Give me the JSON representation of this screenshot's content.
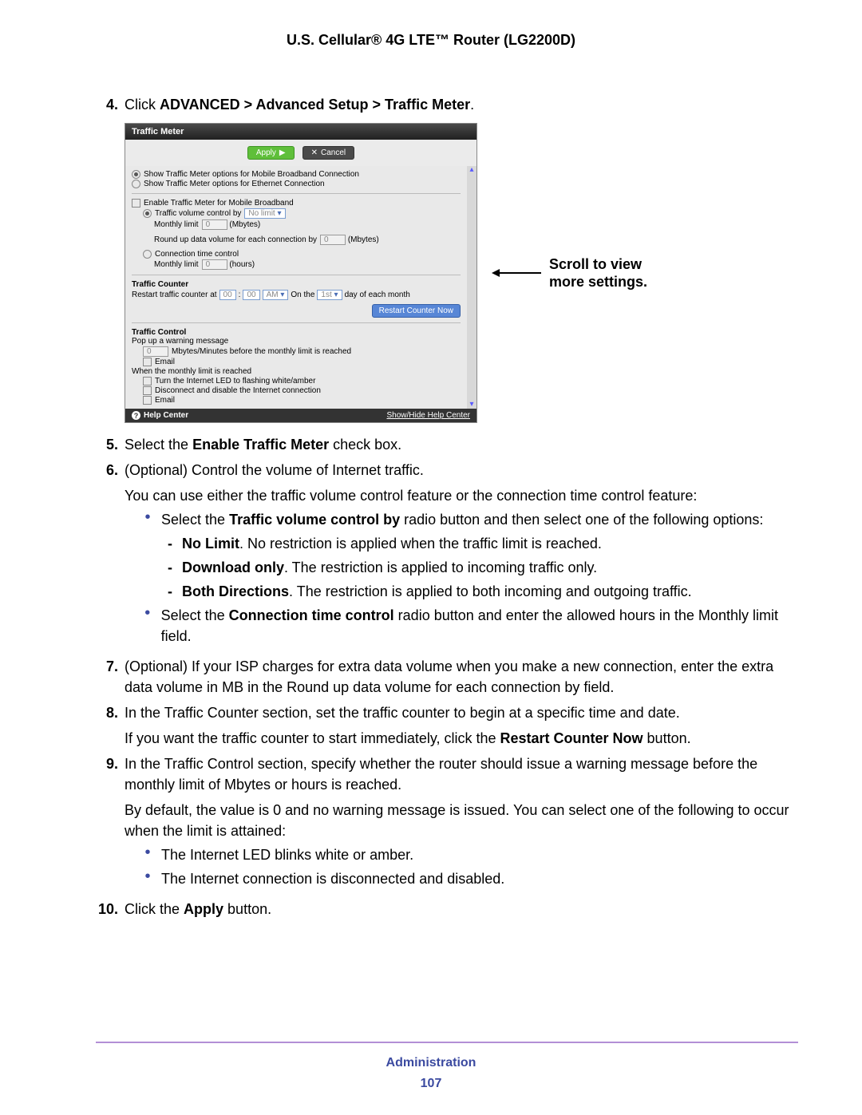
{
  "pageHeader": "U.S. Cellular® 4G LTE™ Router (LG2200D)",
  "callout": "Scroll to view more settings.",
  "shot": {
    "title": "Traffic Meter",
    "apply": "Apply",
    "applyGlyph": "▶",
    "cancel": "Cancel",
    "cancelGlyph": "✕",
    "opt1": "Show Traffic Meter options for Mobile Broadband Connection",
    "opt2": "Show Traffic Meter options for Ethernet Connection",
    "enable": "Enable Traffic Meter for Mobile Broadband",
    "vol_label": "Traffic volume control by",
    "vol_value": "No limit",
    "monthly": "Monthly limit",
    "mbytes": "(Mbytes)",
    "zero": "0",
    "roundup": "Round up data volume for each connection by",
    "conn_time": "Connection time control",
    "monthly2": "Monthly limit",
    "hours": "(hours)",
    "counter_hdr": "Traffic Counter",
    "restart_pre": "Restart traffic counter at",
    "hh": "00",
    "mm": "00",
    "ampm": "AM",
    "onthe": "On the",
    "first": "1st",
    "dayof": "day of each month",
    "restart_btn": "Restart Counter Now",
    "control_hdr": "Traffic Control",
    "popup": "Pop up a warning message",
    "popup_before": "Mbytes/Minutes before the monthly limit is reached",
    "email": "Email",
    "when": "When the monthly limit is reached",
    "led": "Turn the Internet LED to flashing white/amber",
    "disc": "Disconnect and disable the Internet connection",
    "help": "Help Center",
    "help_show": "Show/Hide Help Center"
  },
  "steps": {
    "s4_num": "4.",
    "s4_pre": "Click ",
    "s4_bold": "ADVANCED > Advanced Setup > Traffic Meter",
    "s4_post": ".",
    "s5_num": "5.",
    "s5_pre": "Select the ",
    "s5_bold": "Enable Traffic Meter",
    "s5_post": " check box.",
    "s6_num": "6.",
    "s6": "(Optional) Control the volume of Internet traffic.",
    "s6_p": "You can use either the traffic volume control feature or the connection time control feature:",
    "b1_pre": "Select the ",
    "b1_bold": "Traffic volume control by",
    "b1_post": " radio button and then select one of the following options:",
    "d1_bold": "No Limit",
    "d1_post": ". No restriction is applied when the traffic limit is reached.",
    "d2_bold": "Download only",
    "d2_post": ". The restriction is applied to incoming traffic only.",
    "d3_bold": "Both Directions",
    "d3_post": ". The restriction is applied to both incoming and outgoing traffic.",
    "b2_pre": "Select the ",
    "b2_bold": "Connection time control",
    "b2_post": " radio button and enter the allowed hours in the Monthly limit field.",
    "s7_num": "7.",
    "s7": "(Optional) If your ISP charges for extra data volume when you make a new connection, enter the extra data volume in MB in the Round up data volume for each connection by field.",
    "s8_num": "8.",
    "s8": "In the Traffic Counter section, set the traffic counter to begin at a specific time and date.",
    "s8_p_pre": "If you want the traffic counter to start immediately, click the ",
    "s8_p_bold": "Restart Counter Now",
    "s8_p_post": " button.",
    "s9_num": "9.",
    "s9": "In the Traffic Control section, specify whether the router should issue a warning message before the monthly limit of Mbytes or hours is reached.",
    "s9_p": "By default, the value is 0 and no warning message is issued. You can select one of the following to occur when the limit is attained:",
    "b9a": "The Internet LED blinks white or amber.",
    "b9b": "The Internet connection is disconnected and disabled.",
    "s10_num": "10.",
    "s10_pre": "Click the ",
    "s10_bold": "Apply",
    "s10_post": " button."
  },
  "footer": {
    "section": "Administration",
    "page": "107"
  }
}
